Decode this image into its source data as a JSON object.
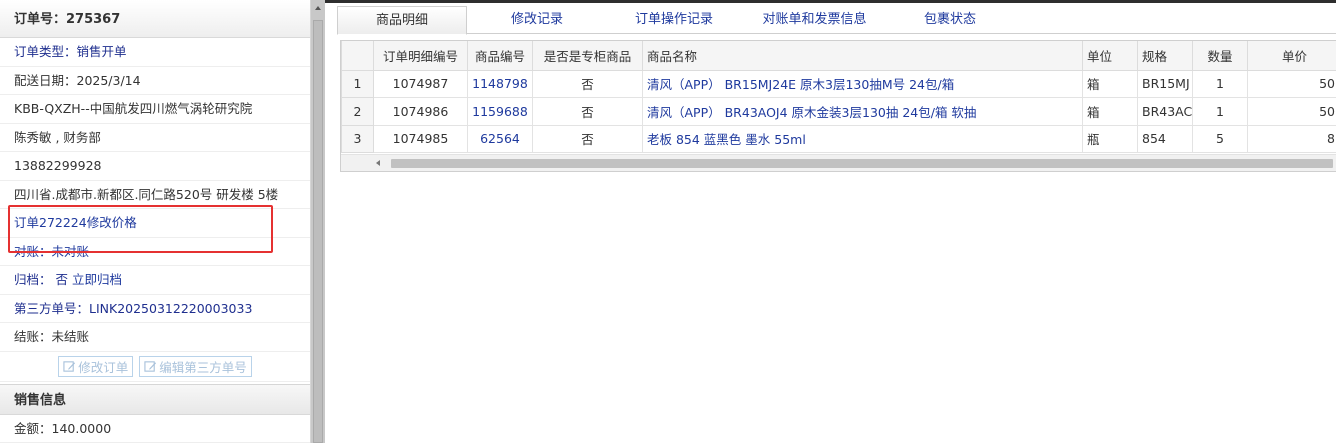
{
  "order": {
    "header": "订单号：275367",
    "type": "订单类型：销售开单",
    "delivery_date": "配送日期：2025/3/14",
    "customer": "KBB-QXZH--中国航发四川燃气涡轮研究院",
    "contact": "陈秀敏 , 财务部",
    "phone": "13882299928",
    "address": "四川省.成都市.新都区.同仁路520号 研发楼 5楼",
    "note_link": "订单272224修改价格",
    "reconcile": "对账：未对账",
    "archive_label": "归档：",
    "archive_value": "否",
    "archive_action": "立即归档",
    "third_party": "第三方单号：LINK20250312220003033",
    "settlement": "结账：未结账",
    "edit_order_label": "修改订单",
    "edit_third_party_label": "编辑第三方单号"
  },
  "sales": {
    "header": "销售信息",
    "amount": "金额：140.0000"
  },
  "tabs": [
    "商品明细",
    "修改记录",
    "订单操作记录",
    "对账单和发票信息",
    "包裹状态"
  ],
  "table": {
    "columns": [
      "",
      "订单明细编号",
      "商品编号",
      "是否是专柜商品",
      "商品名称",
      "单位",
      "规格",
      "数量",
      "单价"
    ],
    "rows": [
      [
        "1",
        "1074987",
        "1148798",
        "否",
        "清风（APP） BR15MJ24E 原木3层130抽M号 24包/箱",
        "箱",
        "BR15MJ",
        "1",
        "50"
      ],
      [
        "2",
        "1074986",
        "1159688",
        "否",
        "清风（APP） BR43AOJ4 原木金装3层130抽 24包/箱 软抽",
        "箱",
        "BR43AC",
        "1",
        "50"
      ],
      [
        "3",
        "1074985",
        "62564",
        "否",
        "老板 854 蓝黑色 墨水 55ml",
        "瓶",
        "854",
        "5",
        "8"
      ]
    ]
  },
  "colors": {
    "highlight": "#e53131",
    "link": "#1f3a9e"
  }
}
